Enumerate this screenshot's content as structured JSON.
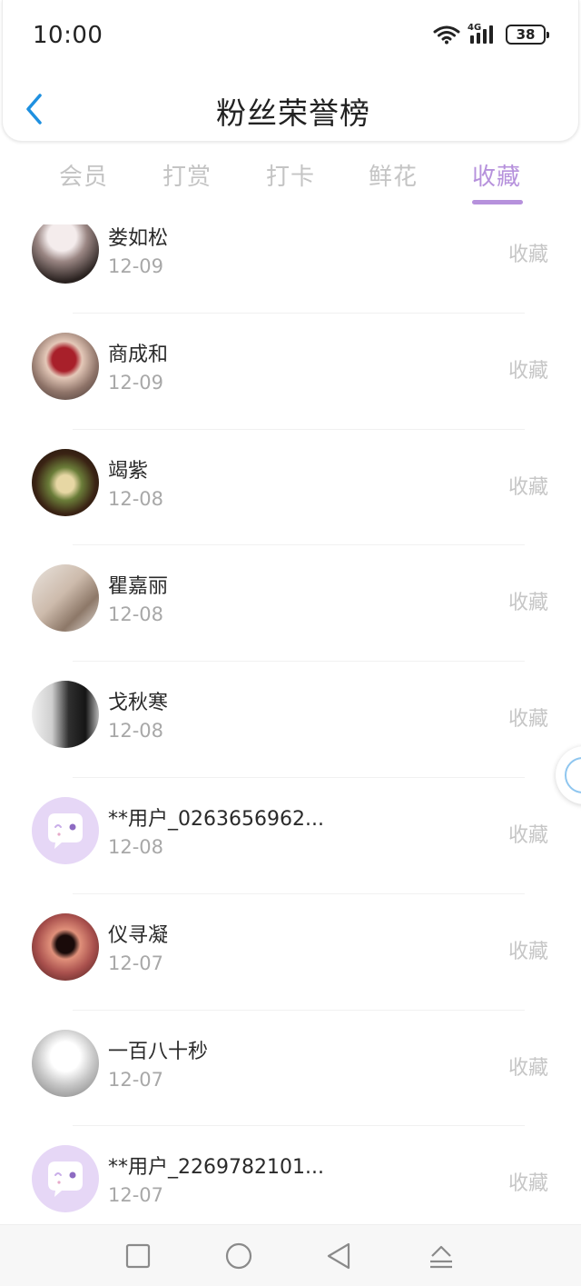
{
  "status_bar": {
    "time": "10:00",
    "network": "4G",
    "battery": "38",
    "icons": [
      "wifi-icon",
      "signal-icon",
      "battery-icon"
    ]
  },
  "header": {
    "title": "粉丝荣誉榜",
    "back_icon": "chevron-left-icon"
  },
  "tabs": [
    {
      "label": "会员",
      "active": false
    },
    {
      "label": "打赏",
      "active": false
    },
    {
      "label": "打卡",
      "active": false
    },
    {
      "label": "鲜花",
      "active": false
    },
    {
      "label": "收藏",
      "active": true
    }
  ],
  "list": {
    "items": [
      {
        "name": "娄如松",
        "date": "12-09",
        "action": "收藏",
        "avatar": "photo"
      },
      {
        "name": "商成和",
        "date": "12-09",
        "action": "收藏",
        "avatar": "photo"
      },
      {
        "name": "竭紫",
        "date": "12-08",
        "action": "收藏",
        "avatar": "photo"
      },
      {
        "name": "瞿嘉丽",
        "date": "12-08",
        "action": "收藏",
        "avatar": "photo"
      },
      {
        "name": "戈秋寒",
        "date": "12-08",
        "action": "收藏",
        "avatar": "photo"
      },
      {
        "name": "**用户_0263656962...",
        "date": "12-08",
        "action": "收藏",
        "avatar": "default-chat-icon"
      },
      {
        "name": "仪寻凝",
        "date": "12-07",
        "action": "收藏",
        "avatar": "photo"
      },
      {
        "name": "一百八十秒",
        "date": "12-07",
        "action": "收藏",
        "avatar": "photo"
      },
      {
        "name": "**用户_2269782101...",
        "date": "12-07",
        "action": "收藏",
        "avatar": "default-chat-icon"
      }
    ]
  },
  "colors": {
    "accent": "#b691dc",
    "inactive_tab": "#c4c4c4",
    "back_arrow": "#1e90e0",
    "default_avatar_bg": "#e6d7f6",
    "default_avatar_icon": "#ffffff"
  },
  "navbar": {
    "buttons": [
      "square-recents-icon",
      "circle-home-icon",
      "triangle-back-icon",
      "upload-arrow-icon"
    ]
  }
}
